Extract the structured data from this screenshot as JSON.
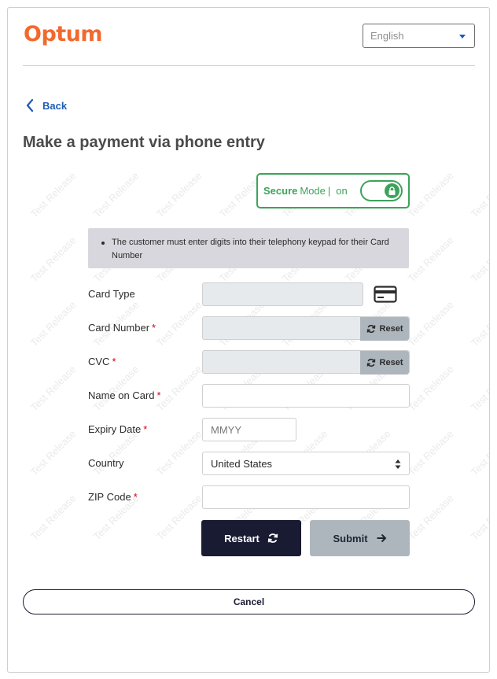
{
  "header": {
    "logo_text": "Optum",
    "language": {
      "selected": "English"
    }
  },
  "nav": {
    "back_label": "Back"
  },
  "page": {
    "title": "Make a payment via phone entry"
  },
  "secure_mode": {
    "label_bold": "Secure",
    "label_rest": "Mode",
    "separator": "|",
    "state": "on"
  },
  "notice": {
    "text": "The customer must enter digits into their telephony keypad for their Card Number"
  },
  "form": {
    "card_type": {
      "label": "Card Type",
      "value": ""
    },
    "card_number": {
      "label": "Card Number",
      "required_mark": "*",
      "reset_label": "Reset"
    },
    "cvc": {
      "label": "CVC",
      "required_mark": "*",
      "reset_label": "Reset"
    },
    "name_on_card": {
      "label": "Name on Card",
      "required_mark": "*",
      "value": ""
    },
    "expiry_date": {
      "label": "Expiry Date",
      "required_mark": "*",
      "placeholder": "MMYY"
    },
    "country": {
      "label": "Country",
      "value": "United States"
    },
    "zip_code": {
      "label": "ZIP Code",
      "required_mark": "*",
      "value": ""
    }
  },
  "actions": {
    "restart_label": "Restart",
    "submit_label": "Submit",
    "cancel_label": "Cancel"
  },
  "watermark": {
    "text": "Test Release"
  },
  "colors": {
    "brand_orange": "#f2692e",
    "link_blue": "#1f5bb5",
    "secure_green": "#3ca35a",
    "navy": "#191b33",
    "disabled_gray": "#aeb6bd",
    "required_red": "#d0021b"
  }
}
